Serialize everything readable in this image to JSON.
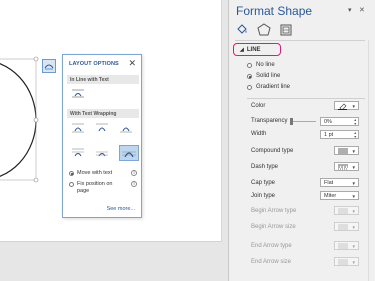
{
  "popup": {
    "title": "LAYOUT OPTIONS",
    "close": "✕",
    "inline_header": "In Line with Text",
    "wrap_header": "With Text Wrapping",
    "move_with_text": "Move with text",
    "fix_position_line1": "Fix position on",
    "fix_position_line2": "page",
    "see_more": "See more..."
  },
  "pane": {
    "title": "Format Shape",
    "dropdown_arrow": "▾",
    "close": "✕",
    "section": "LINE",
    "line_options": [
      "No line",
      "Solid line",
      "Gradient line"
    ],
    "props": {
      "color": "Color",
      "transparency": "Transparency",
      "width": "Width",
      "compound": "Compound type",
      "dash": "Dash type",
      "cap": "Cap type",
      "join": "Join type",
      "begin_arrow_type": "Begin Arrow type",
      "begin_arrow_size": "Begin Arrow size",
      "end_arrow_type": "End Arrow type",
      "end_arrow_size": "End Arrow size"
    },
    "values": {
      "transparency": "0%",
      "width": "1 pt",
      "cap": "Flat",
      "join": "Miter"
    }
  },
  "colors": {
    "accent": "#2b579a",
    "highlight": "#e8157a"
  }
}
